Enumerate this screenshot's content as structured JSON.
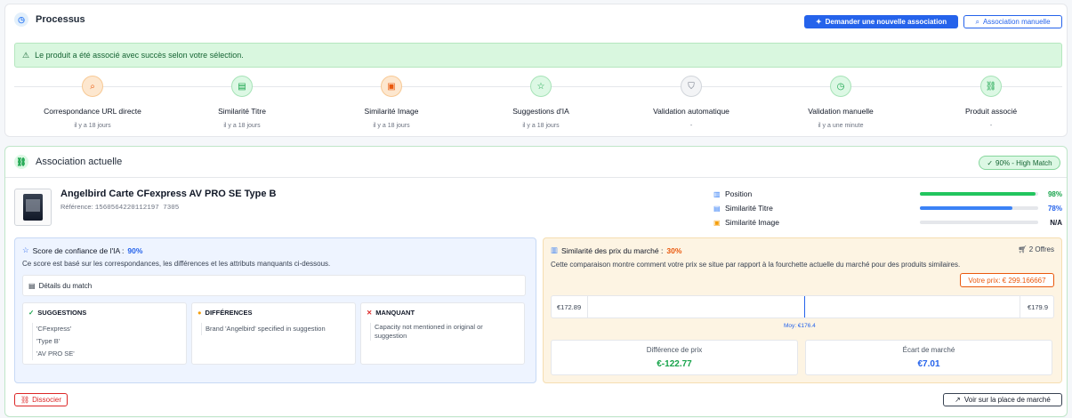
{
  "processus": {
    "title": "Processus",
    "icon": "clock-icon",
    "request_button": "Demander une nouvelle association",
    "manual_button": "Association manuelle",
    "alert": "Le produit a été associé avec succès selon votre sélection.",
    "steps": [
      {
        "label": "Correspondance URL directe",
        "time": "il y a 18 jours",
        "icon": "search-icon",
        "status": "orange"
      },
      {
        "label": "Similarité Titre",
        "time": "il y a 18 jours",
        "icon": "document-icon",
        "status": "green"
      },
      {
        "label": "Similarité Image",
        "time": "il y a 18 jours",
        "icon": "image-icon",
        "status": "orange"
      },
      {
        "label": "Suggestions d'IA",
        "time": "il y a 18 jours",
        "icon": "star-icon",
        "status": "green"
      },
      {
        "label": "Validation automatique",
        "time": "-",
        "icon": "shield-icon",
        "status": "gray"
      },
      {
        "label": "Validation manuelle",
        "time": "il y a une minute",
        "icon": "clock-icon",
        "status": "green"
      },
      {
        "label": "Produit associé",
        "time": "-",
        "icon": "link-icon",
        "status": "green"
      }
    ]
  },
  "association": {
    "title": "Association actuelle",
    "match_badge": "90% - High Match",
    "product_name": "Angelbird Carte CFexpress AV PRO SE Type B",
    "reference_label": "Référence:",
    "reference_value": "1560564220112197 7305",
    "metrics": [
      {
        "label": "Position",
        "value": "98%",
        "fraction": 0.98,
        "color": "#22c55e",
        "value_color": "#16a34a"
      },
      {
        "label": "Similarité Titre",
        "value": "78%",
        "fraction": 0.78,
        "color": "#3b82f6",
        "value_color": "#2563eb"
      },
      {
        "label": "Similarité Image",
        "value": "N/A",
        "fraction": 0,
        "color": "#e5e7eb",
        "value_color": "#111827"
      }
    ],
    "confidence": {
      "title": "Score de confiance de l'IA :",
      "score": "90%",
      "description": "Ce score est basé sur les correspondances, les différences et les attributs manquants ci-dessous.",
      "details_label": "Détails du match",
      "suggestions_title": "SUGGESTIONS",
      "suggestions": [
        "'CFexpress'",
        "'Type B'",
        "'AV PRO SE'"
      ],
      "differences_title": "DIFFÉRENCES",
      "differences": [
        "Brand 'Angelbird' specified in suggestion"
      ],
      "missing_title": "MANQUANT",
      "missing": [
        "Capacity not mentioned in original or",
        "suggestion"
      ]
    },
    "market": {
      "title": "Similarité des prix du marché :",
      "score": "30%",
      "offers": "2 Offres",
      "description": "Cette comparaison montre comment votre prix se situe par rapport à la fourchette actuelle du marché pour des produits similaires.",
      "your_price": "Votre prix: € 299.166667",
      "range_low": "€172.89",
      "range_high": "€179.9",
      "average": "Moy: €176.4",
      "diff_label": "Différence de prix",
      "diff_value": "€-122.77",
      "gap_label": "Écart de marché",
      "gap_value": "€7.01"
    },
    "dissociate_button": "Dissocier",
    "view_button": "Voir sur la place de marché"
  }
}
